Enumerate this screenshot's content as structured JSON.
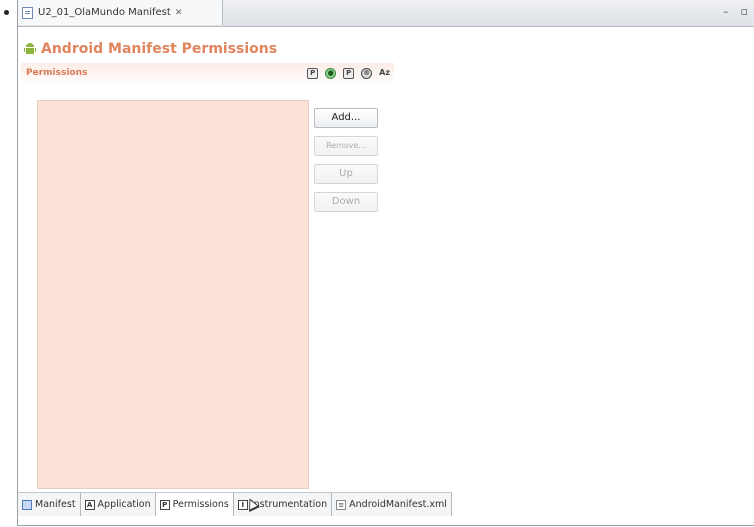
{
  "editor": {
    "tab_title": "U2_01_OlaMundo Manifest",
    "tab_close": "✕",
    "minimize": "–",
    "maximize": "▫"
  },
  "page": {
    "title": "Android Manifest Permissions"
  },
  "section": {
    "label": "Permissions",
    "tool_icons": [
      "P",
      "●",
      "P",
      "®",
      "Az"
    ]
  },
  "buttons": {
    "add": "Add...",
    "remove": "Remove...",
    "up": "Up",
    "down": "Down"
  },
  "bottom_tabs": [
    {
      "label": "Manifest",
      "icon": "manifest-icon"
    },
    {
      "label": "Application",
      "icon": "application-icon"
    },
    {
      "label": "Permissions",
      "icon": "permissions-icon",
      "active": true
    },
    {
      "label": "Instrumentation",
      "icon": "instrumentation-icon"
    },
    {
      "label": "AndroidManifest.xml",
      "icon": "xml-file-icon"
    }
  ],
  "colors": {
    "title": "#e0855e",
    "list_background": "#fbe1d8",
    "android_green": "#8cb33a"
  }
}
